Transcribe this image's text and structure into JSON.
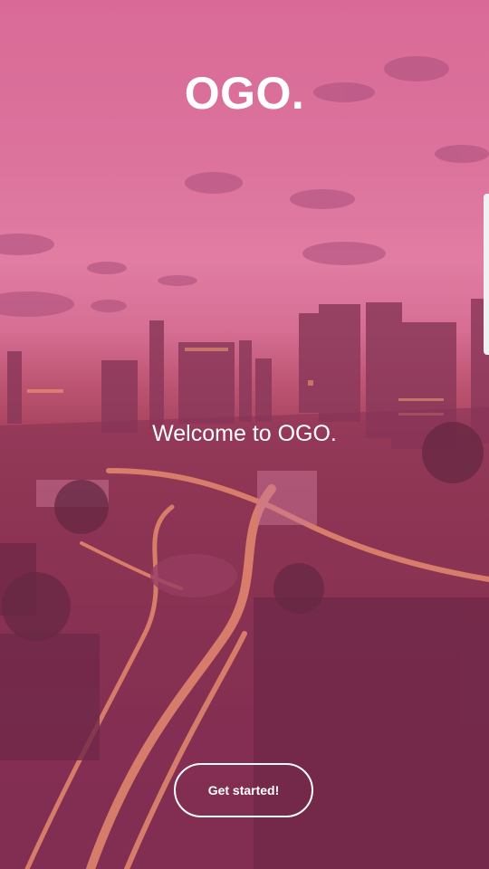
{
  "app": {
    "logo_text": "OGO.",
    "welcome_text": "Welcome to OGO.",
    "get_started_label": "Get started!"
  },
  "colors": {
    "text": "#ffffff",
    "tint": "#d6548c",
    "button_border": "#ffffff"
  },
  "background": {
    "image": "dusk-cityscape"
  }
}
